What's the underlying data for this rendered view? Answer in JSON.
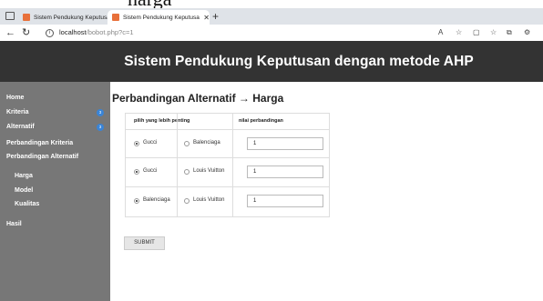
{
  "overlay_caption": "harga",
  "browser": {
    "tabs": [
      {
        "title": "Sistem Pendukung Keputusan m",
        "close": "✕"
      },
      {
        "title": "Sistem Pendukung Keputusan m",
        "close": "✕"
      }
    ],
    "new_tab": "+",
    "url_host": "localhost",
    "url_path": "/bobot.php?c=1",
    "icons": [
      "back-icon",
      "refresh-icon",
      "info-icon",
      "read-aloud-icon",
      "favorite-icon",
      "split-screen-icon",
      "favorites-bar-icon",
      "collections-icon",
      "extensions-icon"
    ]
  },
  "header": {
    "title": "Sistem Pendukung Keputusan dengan metode AHP"
  },
  "sidebar": {
    "items": [
      {
        "label": "Home"
      },
      {
        "label": "Kriteria",
        "badge": "3"
      },
      {
        "label": "Alternatif",
        "badge": "3"
      },
      {
        "label": "Perbandingan Kriteria"
      },
      {
        "label": "Perbandingan Alternatif"
      },
      {
        "label": "Harga"
      },
      {
        "label": "Model"
      },
      {
        "label": "Kualitas"
      },
      {
        "label": "Hasil"
      }
    ]
  },
  "main": {
    "title": "Perbandingan Alternatif → Harga",
    "table": {
      "headers": [
        "pilih yang lebih penting",
        "nilai perbandingan"
      ],
      "rows": [
        {
          "option_a": "Gucci",
          "option_b": "Balenciaga",
          "selected": "a",
          "value": "1"
        },
        {
          "option_a": "Gucci",
          "option_b": "Louis Vuitton",
          "selected": "a",
          "value": "1"
        },
        {
          "option_a": "Balenciaga",
          "option_b": "Louis Vuitton",
          "selected": "a",
          "value": "1"
        }
      ]
    },
    "submit_label": "SUBMIT"
  },
  "colors": {
    "header_bg": "#333333",
    "sidebar_bg": "#777777",
    "badge": "#3a84d6",
    "tab_icon": "#e8703a"
  }
}
